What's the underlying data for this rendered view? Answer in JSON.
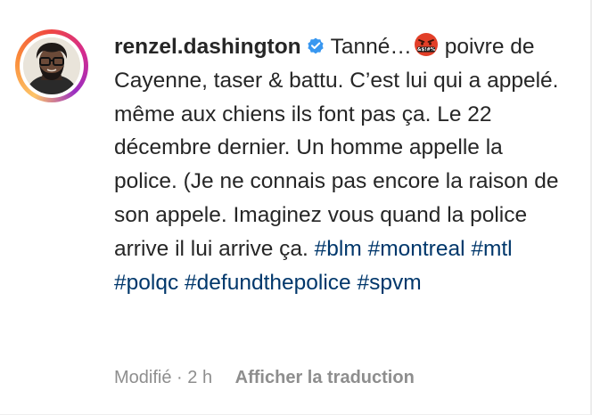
{
  "comment": {
    "username": "renzel.dashington",
    "text_first": "Tanné…",
    "text_rest": " poivre de Cayenne, taser & battu. C’est lui qui a appelé. même aux chiens ils font pas ça. Le 22 décembre dernier. Un homme appelle la police. (Je ne connais pas encore la raison de son appele. Imaginez vous quand la police arrive il lui arrive ça. ",
    "hashtags": [
      "#blm",
      "#montreal",
      "#mtl",
      "#polqc",
      "#defundthepolice",
      "#spvm"
    ],
    "emoji_icon": "cursing-face-emoji",
    "verified_icon": "verified-badge-icon"
  },
  "meta": {
    "edited": "Modifié",
    "separator": "·",
    "time": "2 h",
    "translate": "Afficher la traduction"
  },
  "colors": {
    "text": "#262626",
    "hashtag": "#00376b",
    "muted": "#8e8e8e",
    "verified": "#3897f0"
  }
}
